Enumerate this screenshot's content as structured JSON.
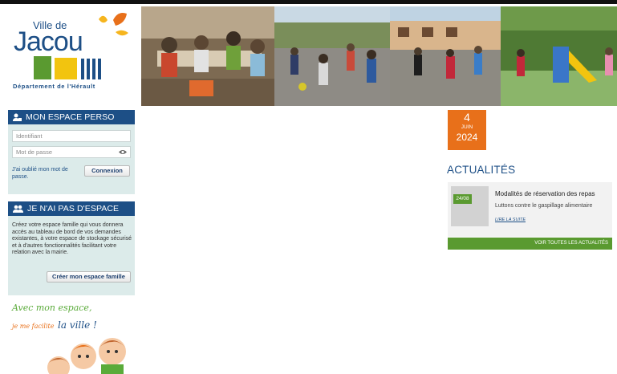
{
  "logo": {
    "ville_de": "Ville de",
    "name": "Jacou",
    "department": "Département de l'Hérault"
  },
  "espace_perso": {
    "title": "Mon espace perso",
    "identifiant_placeholder": "Identifiant",
    "password_placeholder": "Mot de passe",
    "forgot_password": "J'ai oublié mon mot de passe.",
    "login_button": "Connexion"
  },
  "no_space": {
    "title": "Je n'ai pas d'espace",
    "description": "Créez votre espace famille qui vous donnera accès au tableau de bord de vos demandes existantes, à votre espace de stockage sécurisé et à d'autres fonctionnalités facilitant votre relation avec la mairie.",
    "create_button": "Créer mon espace famille"
  },
  "tagline": {
    "line1": "Avec mon espace,",
    "line2_part1": "je me facilite",
    "line2_part2": "la ville !"
  },
  "date": {
    "day": "4",
    "month": "Juin",
    "year": "2024"
  },
  "news": {
    "heading": "Actualités",
    "items": [
      {
        "badge": "24/08",
        "title": "Modalités de réservation des repas",
        "subtitle": "Luttons contre le gaspillage alimentaire",
        "read_more": "Lire la suite"
      }
    ],
    "all_news_link": "Voir toutes les actualités"
  },
  "colors": {
    "brand_blue": "#1d4f86",
    "orange": "#e8701a",
    "green": "#5a9a30",
    "panel_bg": "#dcebea"
  },
  "icons": {
    "espace_perso": "user-lock-icon",
    "no_space": "users-icon",
    "password_toggle": "eye-icon"
  }
}
